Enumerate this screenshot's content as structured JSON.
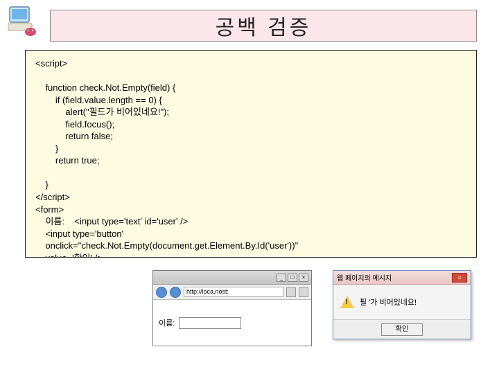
{
  "title": "공백 검증",
  "code": "<script>\n\n    function check.Not.Empty(field) {\n        if (field.value.length == 0) {\n            alert(\"필드가 비어있네요!\");\n            field.focus();\n            return false;\n        }\n        return true;\n\n    }\n</script>\n<form>\n    이름:    <input type='text' id='user' />\n    <input type='button'\n    onclick=\"check.Not.Empty(document.get.Element.By.Id('user'))\"\n    value='확인' />\n</form>",
  "browser": {
    "address": "http://loca.nost:",
    "label": "이름:",
    "min": "_",
    "max": "□",
    "close": "×"
  },
  "alert": {
    "title": "웹 페이지의 메시지",
    "message": "필 '가 비어있네요!",
    "ok": "확인",
    "close": "×"
  }
}
